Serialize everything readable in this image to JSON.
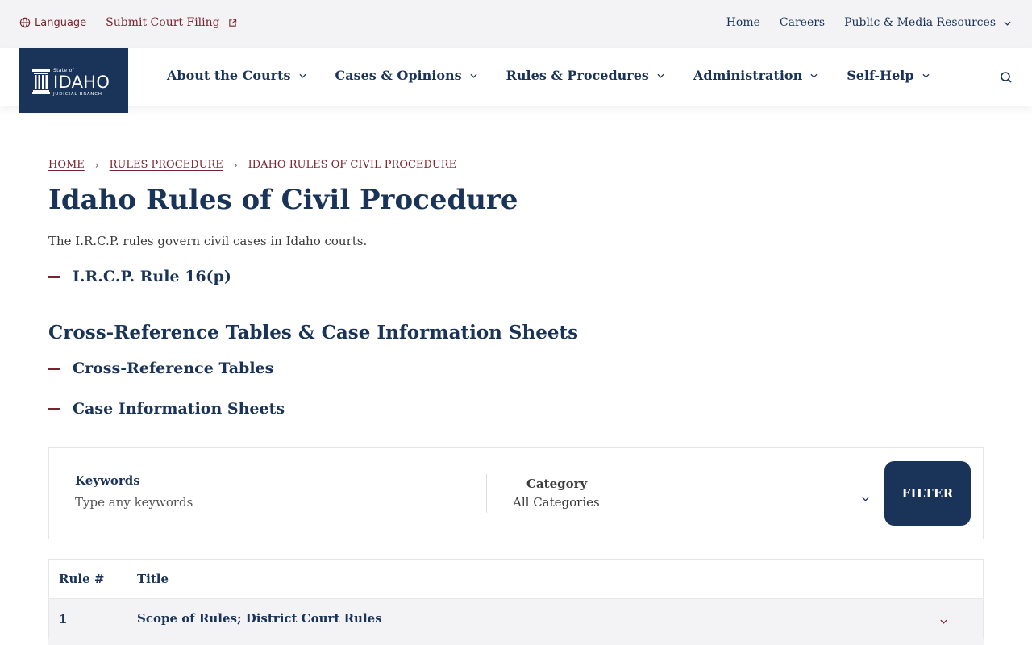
{
  "utility": {
    "language_label": "Language",
    "submit_filing_label": "Submit Court Filing",
    "links": [
      {
        "label": "Home"
      },
      {
        "label": "Careers"
      },
      {
        "label": "Public & Media Resources"
      }
    ]
  },
  "logo": {
    "state": "State of",
    "name": "IDAHO",
    "subtitle": "JUDICIAL BRANCH"
  },
  "nav": {
    "items": [
      {
        "label": "About the Courts"
      },
      {
        "label": "Cases & Opinions"
      },
      {
        "label": "Rules & Procedures"
      },
      {
        "label": "Administration"
      },
      {
        "label": "Self-Help"
      }
    ]
  },
  "breadcrumb": {
    "items": [
      "HOME",
      "RULES PROCEDURE",
      "IDAHO RULES OF CIVIL PROCEDURE"
    ]
  },
  "page": {
    "title": "Idaho Rules of Civil Procedure",
    "intro": "The I.R.C.P. rules govern civil cases in Idaho courts.",
    "accordion_rule": "I.R.C.P. Rule 16(p)",
    "section_title": "Cross-Reference Tables & Case Information Sheets",
    "accordion_items": [
      "Cross-Reference Tables",
      "Case Information Sheets"
    ]
  },
  "filter": {
    "keywords_label": "Keywords",
    "keywords_placeholder": "Type any keywords",
    "category_label": "Category",
    "category_value": "All Categories",
    "button_label": "FILTER"
  },
  "table": {
    "headers": [
      "Rule #",
      "Title"
    ],
    "rows": [
      {
        "num": "1",
        "title": "Scope of Rules; District Court Rules"
      }
    ]
  },
  "colors": {
    "navy": "#1a3358",
    "maroon": "#7a2430",
    "light_gray": "#f3f3f5"
  },
  "icons": [
    "globe-icon",
    "external-link-icon",
    "chevron-down-icon",
    "search-icon",
    "pillar-logo-icon"
  ]
}
